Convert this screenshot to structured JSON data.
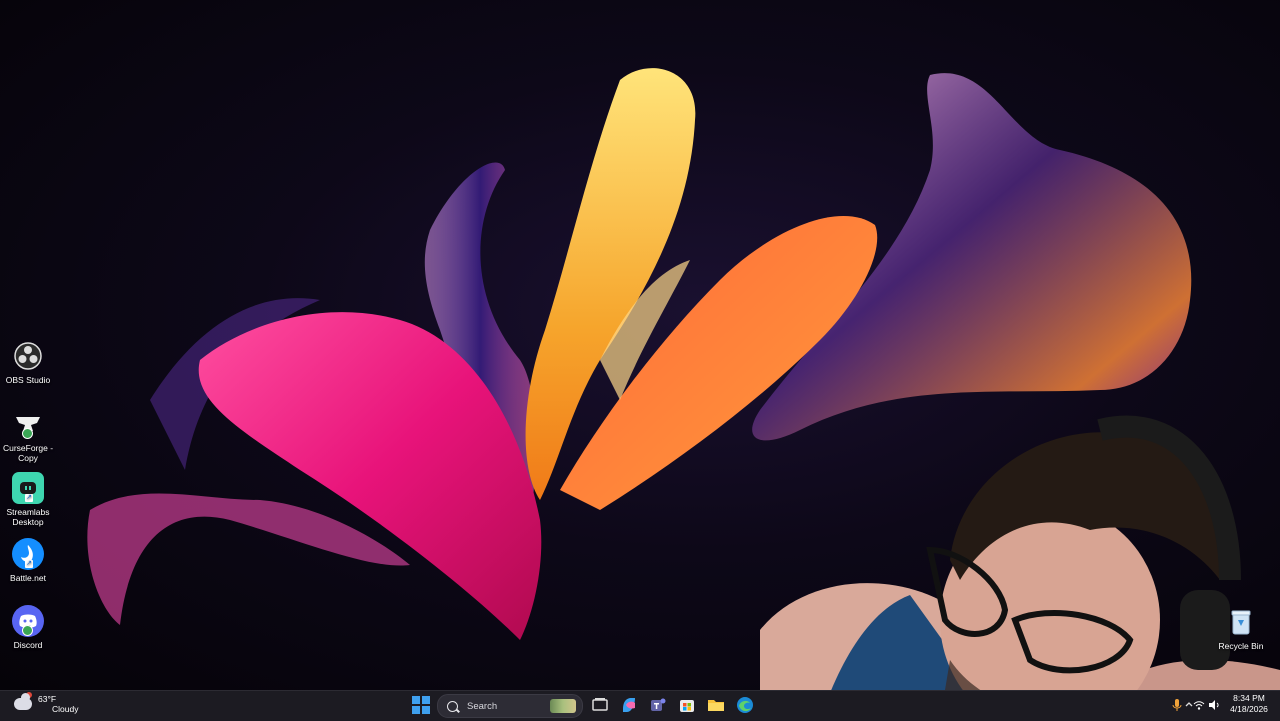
{
  "desktop": {
    "icons": [
      {
        "label": "OBS Studio",
        "icon": "obs-icon"
      },
      {
        "label": "CurseForge - Copy",
        "icon": "curseforge-icon"
      },
      {
        "label": "Streamlabs Desktop",
        "icon": "streamlabs-icon"
      },
      {
        "label": "Battle.net",
        "icon": "battlenet-icon"
      },
      {
        "label": "Discord",
        "icon": "discord-icon"
      }
    ],
    "recycle_bin": {
      "label": "Recycle Bin",
      "icon": "recycle-bin-icon"
    }
  },
  "taskbar": {
    "weather": {
      "temp": "63°F",
      "condition": "Cloudy",
      "icon": "cloudy-weather-icon"
    },
    "search": {
      "placeholder": "Search"
    },
    "pinned_apps": [
      "start-icon",
      "task-view-icon",
      "copilot-icon",
      "teams-icon",
      "microsoft-store-icon",
      "file-explorer-icon",
      "edge-icon"
    ],
    "clock": {
      "time": "8:34 PM",
      "date": "4/18/2026"
    }
  },
  "colors": {
    "taskbar_bg": "#1c1b22",
    "accent": "#3fa0ee"
  }
}
